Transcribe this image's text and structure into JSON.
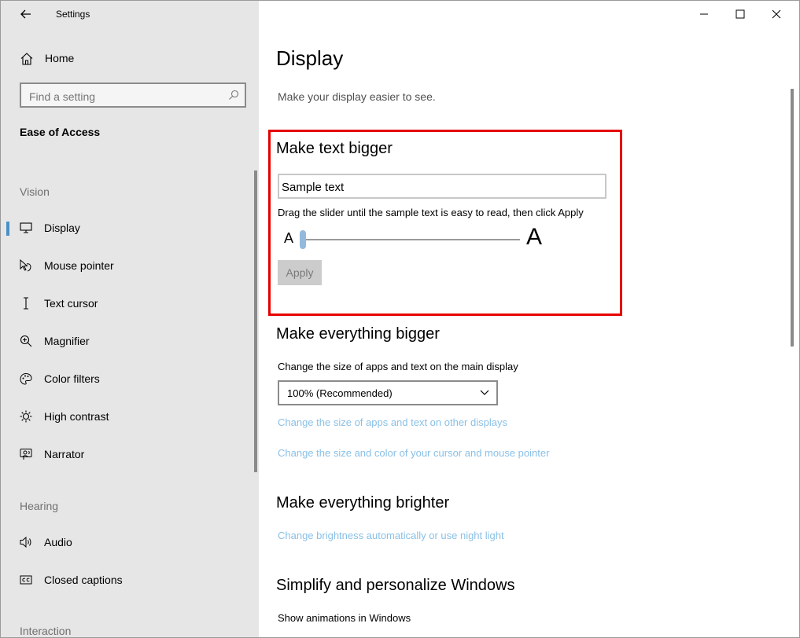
{
  "app": {
    "title": "Settings"
  },
  "sidebar": {
    "home_label": "Home",
    "search_placeholder": "Find a setting",
    "section_title": "Ease of Access",
    "group_vision": "Vision",
    "vision_items": [
      {
        "label": "Display",
        "icon": "display-icon"
      },
      {
        "label": "Mouse pointer",
        "icon": "mouse-pointer-icon"
      },
      {
        "label": "Text cursor",
        "icon": "text-cursor-icon"
      },
      {
        "label": "Magnifier",
        "icon": "magnifier-icon"
      },
      {
        "label": "Color filters",
        "icon": "color-filters-icon"
      },
      {
        "label": "High contrast",
        "icon": "high-contrast-icon"
      },
      {
        "label": "Narrator",
        "icon": "narrator-icon"
      }
    ],
    "group_hearing": "Hearing",
    "hearing_items": [
      {
        "label": "Audio",
        "icon": "audio-icon"
      },
      {
        "label": "Closed captions",
        "icon": "closed-captions-icon"
      }
    ],
    "group_interaction": "Interaction"
  },
  "main": {
    "title": "Display",
    "subtitle": "Make your display easier to see.",
    "text_bigger": {
      "heading": "Make text bigger",
      "sample_text": "Sample text",
      "instructions": "Drag the slider until the sample text is easy to read, then click Apply",
      "slider_small_label": "A",
      "slider_large_label": "A",
      "slider_value_fraction": 0,
      "apply_label": "Apply"
    },
    "everything_bigger": {
      "heading": "Make everything bigger",
      "description": "Change the size of apps and text on the main display",
      "dropdown_value": "100% (Recommended)",
      "link_other_displays": "Change the size of apps and text on other displays",
      "link_cursor": "Change the size and color of your cursor and mouse pointer"
    },
    "everything_brighter": {
      "heading": "Make everything brighter",
      "link_brightness": "Change brightness automatically or use night light"
    },
    "simplify": {
      "heading": "Simplify and personalize Windows",
      "show_animations": "Show animations in Windows"
    }
  },
  "colors": {
    "sidebar_bg": "#e6e6e6",
    "accent": "#4a90c6",
    "highlight_border": "#e60000",
    "link": "#8ac0e6"
  }
}
